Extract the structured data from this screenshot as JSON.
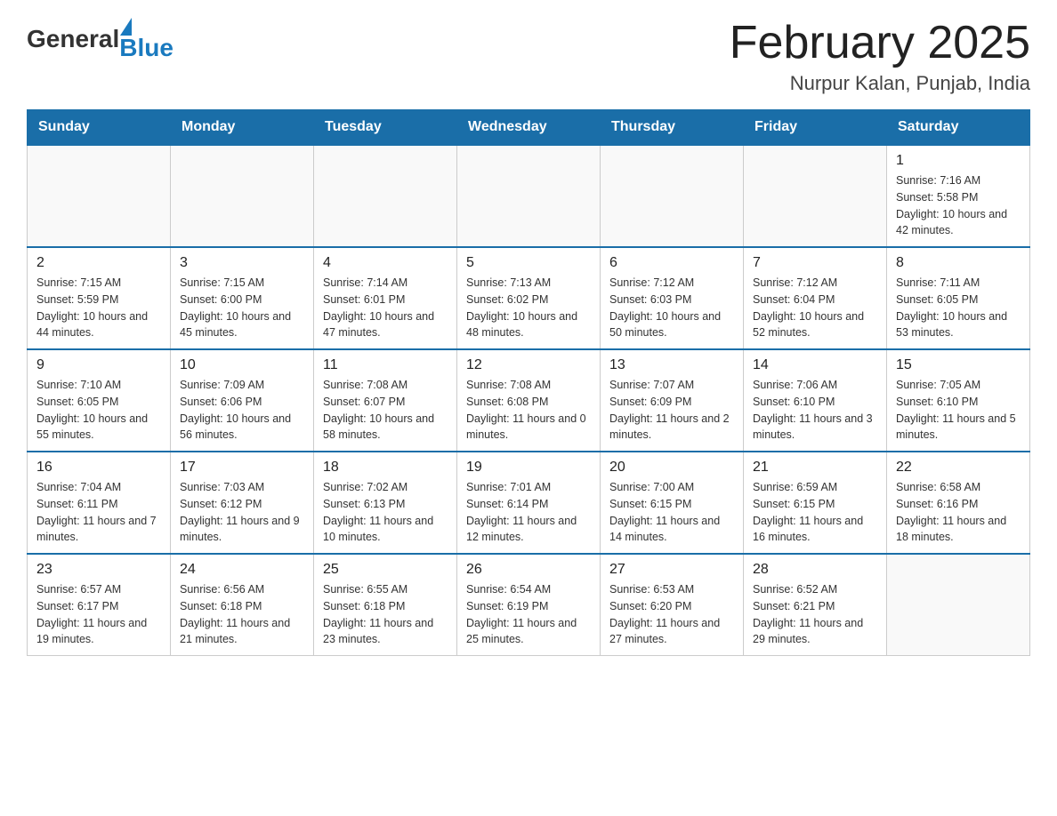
{
  "logo": {
    "general": "General",
    "blue": "Blue",
    "triangle": "▶"
  },
  "header": {
    "month_title": "February 2025",
    "location": "Nurpur Kalan, Punjab, India"
  },
  "weekdays": [
    "Sunday",
    "Monday",
    "Tuesday",
    "Wednesday",
    "Thursday",
    "Friday",
    "Saturday"
  ],
  "weeks": [
    [
      {
        "day": "",
        "info": ""
      },
      {
        "day": "",
        "info": ""
      },
      {
        "day": "",
        "info": ""
      },
      {
        "day": "",
        "info": ""
      },
      {
        "day": "",
        "info": ""
      },
      {
        "day": "",
        "info": ""
      },
      {
        "day": "1",
        "info": "Sunrise: 7:16 AM\nSunset: 5:58 PM\nDaylight: 10 hours and 42 minutes."
      }
    ],
    [
      {
        "day": "2",
        "info": "Sunrise: 7:15 AM\nSunset: 5:59 PM\nDaylight: 10 hours and 44 minutes."
      },
      {
        "day": "3",
        "info": "Sunrise: 7:15 AM\nSunset: 6:00 PM\nDaylight: 10 hours and 45 minutes."
      },
      {
        "day": "4",
        "info": "Sunrise: 7:14 AM\nSunset: 6:01 PM\nDaylight: 10 hours and 47 minutes."
      },
      {
        "day": "5",
        "info": "Sunrise: 7:13 AM\nSunset: 6:02 PM\nDaylight: 10 hours and 48 minutes."
      },
      {
        "day": "6",
        "info": "Sunrise: 7:12 AM\nSunset: 6:03 PM\nDaylight: 10 hours and 50 minutes."
      },
      {
        "day": "7",
        "info": "Sunrise: 7:12 AM\nSunset: 6:04 PM\nDaylight: 10 hours and 52 minutes."
      },
      {
        "day": "8",
        "info": "Sunrise: 7:11 AM\nSunset: 6:05 PM\nDaylight: 10 hours and 53 minutes."
      }
    ],
    [
      {
        "day": "9",
        "info": "Sunrise: 7:10 AM\nSunset: 6:05 PM\nDaylight: 10 hours and 55 minutes."
      },
      {
        "day": "10",
        "info": "Sunrise: 7:09 AM\nSunset: 6:06 PM\nDaylight: 10 hours and 56 minutes."
      },
      {
        "day": "11",
        "info": "Sunrise: 7:08 AM\nSunset: 6:07 PM\nDaylight: 10 hours and 58 minutes."
      },
      {
        "day": "12",
        "info": "Sunrise: 7:08 AM\nSunset: 6:08 PM\nDaylight: 11 hours and 0 minutes."
      },
      {
        "day": "13",
        "info": "Sunrise: 7:07 AM\nSunset: 6:09 PM\nDaylight: 11 hours and 2 minutes."
      },
      {
        "day": "14",
        "info": "Sunrise: 7:06 AM\nSunset: 6:10 PM\nDaylight: 11 hours and 3 minutes."
      },
      {
        "day": "15",
        "info": "Sunrise: 7:05 AM\nSunset: 6:10 PM\nDaylight: 11 hours and 5 minutes."
      }
    ],
    [
      {
        "day": "16",
        "info": "Sunrise: 7:04 AM\nSunset: 6:11 PM\nDaylight: 11 hours and 7 minutes."
      },
      {
        "day": "17",
        "info": "Sunrise: 7:03 AM\nSunset: 6:12 PM\nDaylight: 11 hours and 9 minutes."
      },
      {
        "day": "18",
        "info": "Sunrise: 7:02 AM\nSunset: 6:13 PM\nDaylight: 11 hours and 10 minutes."
      },
      {
        "day": "19",
        "info": "Sunrise: 7:01 AM\nSunset: 6:14 PM\nDaylight: 11 hours and 12 minutes."
      },
      {
        "day": "20",
        "info": "Sunrise: 7:00 AM\nSunset: 6:15 PM\nDaylight: 11 hours and 14 minutes."
      },
      {
        "day": "21",
        "info": "Sunrise: 6:59 AM\nSunset: 6:15 PM\nDaylight: 11 hours and 16 minutes."
      },
      {
        "day": "22",
        "info": "Sunrise: 6:58 AM\nSunset: 6:16 PM\nDaylight: 11 hours and 18 minutes."
      }
    ],
    [
      {
        "day": "23",
        "info": "Sunrise: 6:57 AM\nSunset: 6:17 PM\nDaylight: 11 hours and 19 minutes."
      },
      {
        "day": "24",
        "info": "Sunrise: 6:56 AM\nSunset: 6:18 PM\nDaylight: 11 hours and 21 minutes."
      },
      {
        "day": "25",
        "info": "Sunrise: 6:55 AM\nSunset: 6:18 PM\nDaylight: 11 hours and 23 minutes."
      },
      {
        "day": "26",
        "info": "Sunrise: 6:54 AM\nSunset: 6:19 PM\nDaylight: 11 hours and 25 minutes."
      },
      {
        "day": "27",
        "info": "Sunrise: 6:53 AM\nSunset: 6:20 PM\nDaylight: 11 hours and 27 minutes."
      },
      {
        "day": "28",
        "info": "Sunrise: 6:52 AM\nSunset: 6:21 PM\nDaylight: 11 hours and 29 minutes."
      },
      {
        "day": "",
        "info": ""
      }
    ]
  ]
}
